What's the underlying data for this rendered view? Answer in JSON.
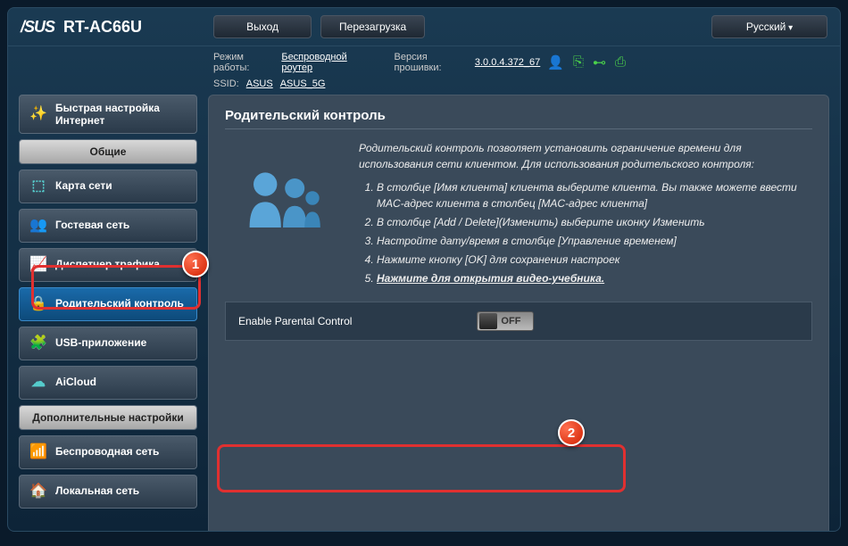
{
  "header": {
    "brand": "/SUS",
    "model": "RT-AC66U",
    "logout": "Выход",
    "reboot": "Перезагрузка",
    "language": "Русский"
  },
  "info": {
    "mode_label": "Режим работы:",
    "mode_value": "Беспроводной роутер",
    "fw_label": "Версия прошивки:",
    "fw_value": "3.0.0.4.372_67",
    "ssid_label": "SSID:",
    "ssid1": "ASUS",
    "ssid2": "ASUS_5G"
  },
  "sidebar": {
    "qis": "Быстрая настройка Интернет",
    "general": "Общие",
    "items": [
      {
        "label": "Карта сети"
      },
      {
        "label": "Гостевая сеть"
      },
      {
        "label": "Диспетчер трафика"
      },
      {
        "label": "Родительский контроль"
      },
      {
        "label": "USB-приложение"
      },
      {
        "label": "AiCloud"
      }
    ],
    "advanced": "Дополнительные настройки",
    "adv_items": [
      {
        "label": "Беспроводная сеть"
      },
      {
        "label": "Локальная сеть"
      }
    ]
  },
  "content": {
    "title": "Родительский контроль",
    "intro": "Родительский контроль позволяет установить ограничение времени для использования сети клиентом. Для использования родительского контроля:",
    "steps": [
      "В столбце [Имя клиента] клиента выберите клиента. Вы также можете ввести MAC-адрес клиента в столбец [MAC-адрес клиента]",
      "В столбце [Add / Delete](Изменить) выберите иконку Изменить",
      "Настройте дату/время в столбце [Управление временем]",
      "Нажмите кнопку [OK] для сохранения настроек"
    ],
    "video_link": "Нажмите для открытия видео-учебника.",
    "toggle_label": "Enable Parental Control",
    "toggle_state": "OFF"
  },
  "annotations": {
    "badge1": "1",
    "badge2": "2"
  }
}
